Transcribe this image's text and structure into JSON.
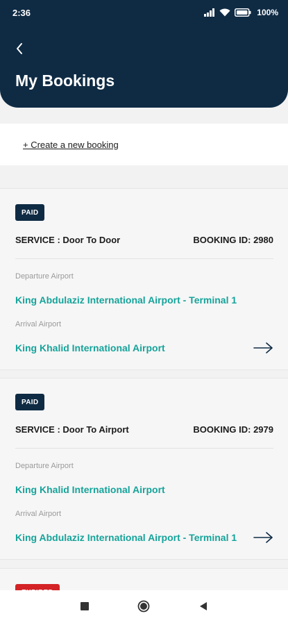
{
  "status_bar": {
    "time": "2:36",
    "battery": "100%"
  },
  "header": {
    "title": "My Bookings"
  },
  "create_booking": {
    "label": "+ Create a new booking"
  },
  "bookings": [
    {
      "status": "PAID",
      "service": "SERVICE : Door To Door",
      "booking_id": "BOOKING ID: 2980",
      "departure_label": "Departure Airport",
      "departure": "King Abdulaziz International Airport - Terminal 1",
      "arrival_label": "Arrival Airport",
      "arrival": "King Khalid International Airport"
    },
    {
      "status": "PAID",
      "service": "SERVICE : Door To Airport",
      "booking_id": "BOOKING ID: 2979",
      "departure_label": "Departure Airport",
      "departure": "King Khalid International Airport",
      "arrival_label": "Arrival Airport",
      "arrival": "King Abdulaziz International Airport - Terminal 1"
    },
    {
      "status": "EXPIRED"
    }
  ],
  "colors": {
    "header_bg": "#0f2b44",
    "accent_teal": "#15a39a",
    "expired_red": "#d32326"
  }
}
